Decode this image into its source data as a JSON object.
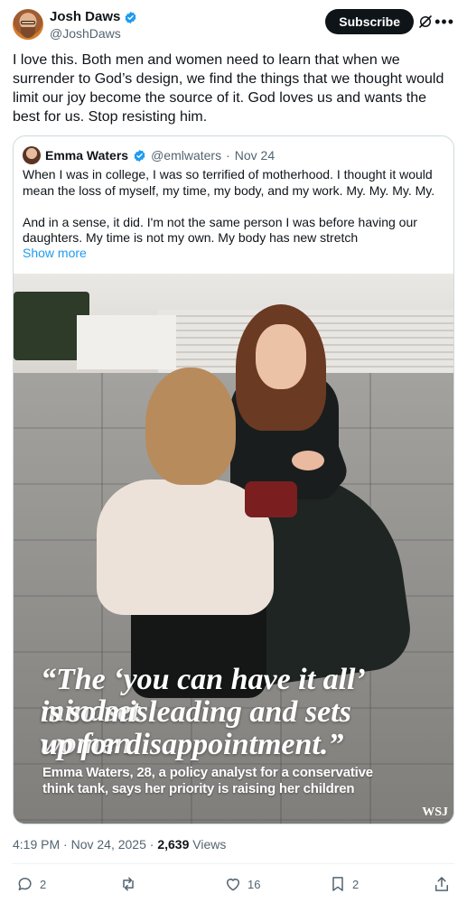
{
  "author": {
    "display_name": "Josh Daws",
    "handle": "@JoshDaws",
    "verified": true,
    "subscribe_label": "Subscribe"
  },
  "tweet": {
    "text": "I love this. Both men and women need to learn that when we surrender to God’s design, we find the things that we thought would limit our joy become the source of it. God loves us and wants the best for us. Stop resisting him.",
    "time": "4:19 PM",
    "date": "Nov 24, 2025",
    "views_count": "2,639",
    "views_label": "Views"
  },
  "quoted": {
    "display_name": "Emma Waters",
    "handle": "@emlwaters",
    "date": "Nov 24",
    "paragraph_1": "When I was in college, I was so terrified of motherhood. I thought it would mean the loss of myself, my time, my body, and my work. My. My. My. My.",
    "paragraph_2": "And in a sense, it did. I'm not the same person I was before having our daughters. My time is not my own. My body has new stretch",
    "show_more": "Show more",
    "image": {
      "quote_line_1": "“The ‘you can have it all’ mindset",
      "quote_line_2": "is so misleading and sets women",
      "quote_line_3": "up for disappointment.”",
      "caption_line_1": "Emma Waters, 28, a policy analyst for a conservative",
      "caption_line_2": "think tank, says her priority is raising her children",
      "watermark": "WSJ"
    }
  },
  "actions": {
    "replies": "2",
    "reposts": "",
    "likes": "16",
    "bookmarks": "2"
  },
  "colors": {
    "accent": "#1d9bf0",
    "text": "#0f1419",
    "secondary": "#536471",
    "border": "#cfd9de"
  },
  "icons": [
    "verified-badge-icon",
    "grok-icon",
    "more-icon",
    "reply-icon",
    "repost-icon",
    "like-icon",
    "bookmark-icon",
    "share-icon"
  ]
}
